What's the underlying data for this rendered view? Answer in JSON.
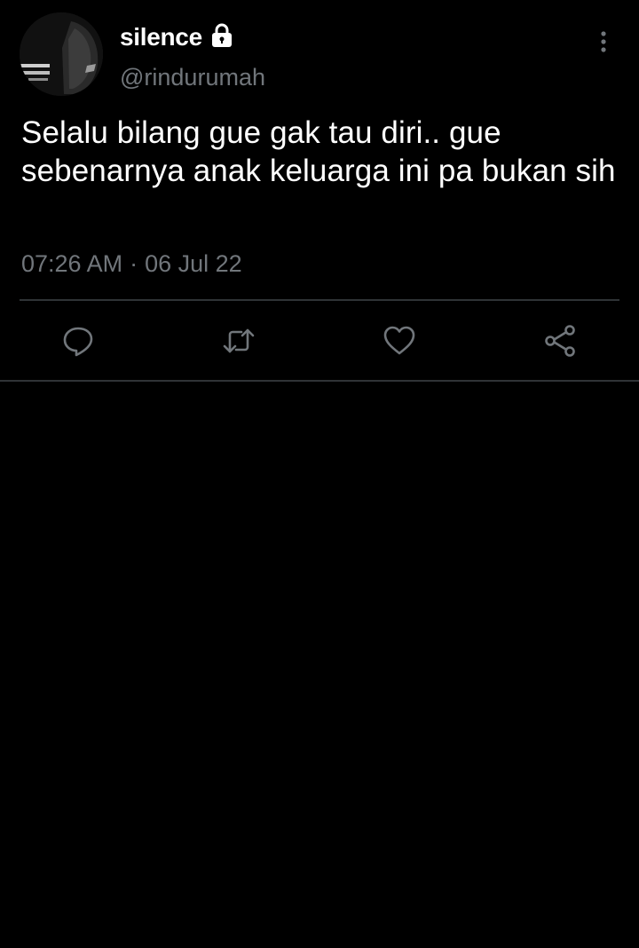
{
  "tweet": {
    "display_name": "silence",
    "handle": "@rindurumah",
    "text": "Selalu bilang gue gak tau diri.. gue sebenarnya anak keluarga ini pa bukan sih",
    "time": "07:26 AM",
    "separator": "·",
    "date": "06 Jul 22",
    "protected_icon": "lock-icon",
    "more_icon": "more-vertical-icon"
  },
  "actions": [
    {
      "icon": "reply-icon"
    },
    {
      "icon": "retweet-icon"
    },
    {
      "icon": "like-icon"
    },
    {
      "icon": "share-icon"
    }
  ],
  "colors": {
    "background": "#000000",
    "text_primary": "#ffffff",
    "text_secondary": "#71767b",
    "divider": "#2f3336"
  }
}
